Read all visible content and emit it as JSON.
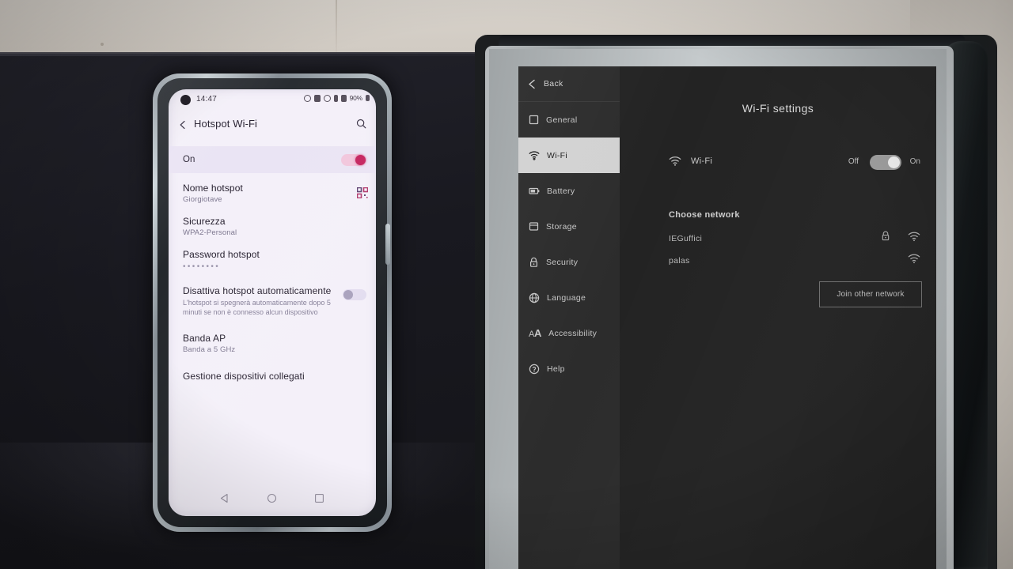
{
  "scene": {
    "description": "Photo of a smartphone showing Italian hotspot settings next to an e-ink tablet showing Wi-Fi settings"
  },
  "phone": {
    "status_bar": {
      "time": "14:47",
      "battery_percent": "90%",
      "icons": [
        "alarm-icon",
        "nfc-icon",
        "dnd-icon",
        "vibrate-icon",
        "signal-icon",
        "battery-icon"
      ]
    },
    "app_bar": {
      "back_label": "back-arrow-icon",
      "title": "Hotspot Wi-Fi",
      "search_label": "search-icon"
    },
    "master_toggle": {
      "label": "On",
      "state": "on",
      "accent": "#c4215c"
    },
    "items": [
      {
        "title": "Nome hotspot",
        "subtitle": "Giorgiotave",
        "trailing": "qr-code-icon"
      },
      {
        "title": "Sicurezza",
        "subtitle": "WPA2-Personal",
        "trailing": ""
      },
      {
        "title": "Password hotspot",
        "subtitle": "••••••••",
        "trailing": ""
      },
      {
        "title": "Disattiva hotspot automaticamente",
        "subtitle": "L'hotspot si spegnerà automaticamente dopo 5 minuti se non è connesso alcun dispositivo",
        "trailing": "toggle-off"
      },
      {
        "title": "Banda AP",
        "subtitle": "Banda a 5 GHz",
        "trailing": ""
      },
      {
        "title": "Gestione dispositivi collegati",
        "subtitle": "",
        "trailing": ""
      }
    ],
    "nav_bar": {
      "back": "nav-back-icon",
      "home": "nav-home-icon",
      "recents": "nav-recents-icon"
    }
  },
  "tablet": {
    "sidebar": {
      "back_label": "Back",
      "items": [
        {
          "label": "General",
          "icon": "square-icon",
          "active": false
        },
        {
          "label": "Wi-Fi",
          "icon": "wifi-icon",
          "active": true
        },
        {
          "label": "Battery",
          "icon": "battery-icon",
          "active": false
        },
        {
          "label": "Storage",
          "icon": "storage-icon",
          "active": false
        },
        {
          "label": "Security",
          "icon": "lock-icon",
          "active": false
        },
        {
          "label": "Language",
          "icon": "globe-icon",
          "active": false
        },
        {
          "label": "Accessibility",
          "icon": "text-size-icon",
          "active": false
        },
        {
          "label": "Help",
          "icon": "question-mark-icon",
          "active": false
        }
      ]
    },
    "main": {
      "title": "Wi-Fi settings",
      "wifi_row": {
        "label": "Wi-Fi",
        "icon": "wifi-icon",
        "off_label": "Off",
        "on_label": "On",
        "state": "on"
      },
      "choose_network_label": "Choose network",
      "networks": [
        {
          "name": "IEGuffici",
          "secured": true,
          "signal": "wifi-signal-icon"
        },
        {
          "name": "palas",
          "secured": false,
          "signal": "wifi-signal-icon"
        }
      ],
      "join_button_label": "Join other network"
    }
  }
}
